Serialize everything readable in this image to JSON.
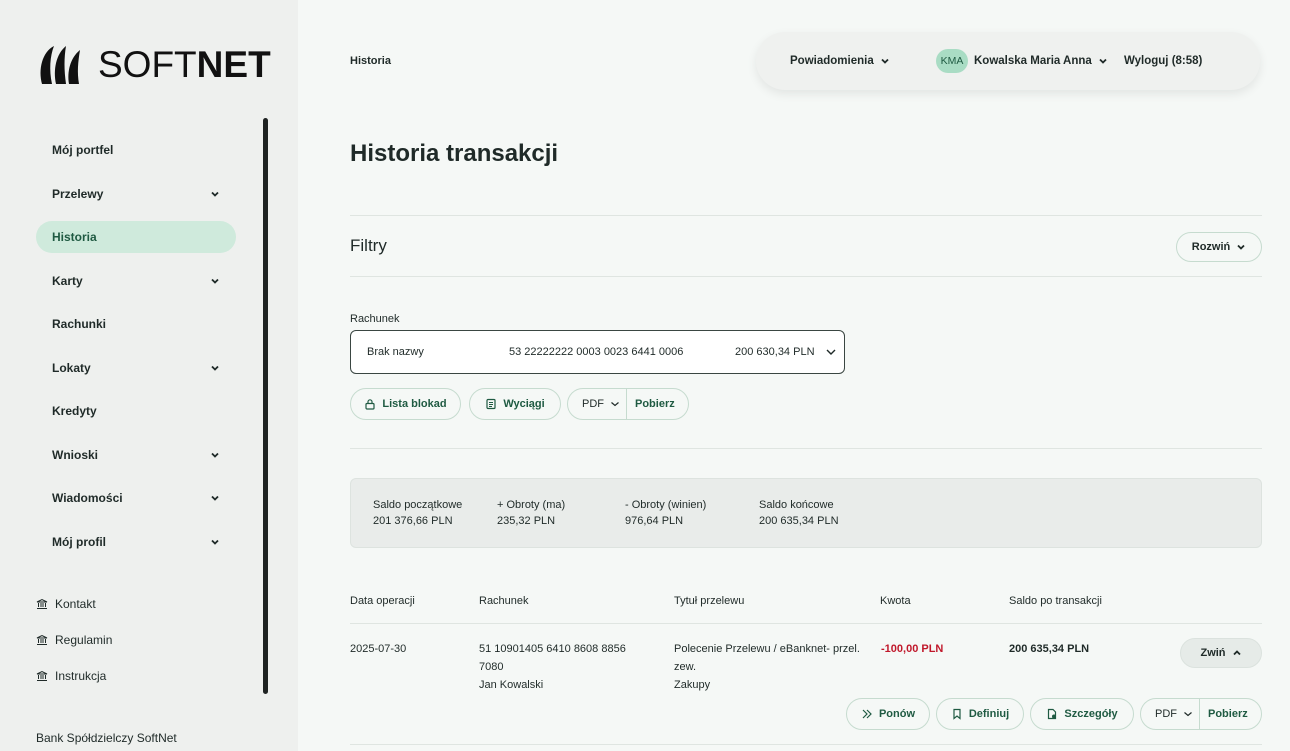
{
  "brand": {
    "logo_prefix": "SOFT",
    "logo_bold": "NET",
    "bank_name": "Bank Spółdzielczy SoftNet"
  },
  "sidebar": {
    "items": [
      {
        "label": "Mój portfel",
        "has_chevron": false,
        "active": false
      },
      {
        "label": "Przelewy",
        "has_chevron": true,
        "active": false
      },
      {
        "label": "Historia",
        "has_chevron": false,
        "active": true
      },
      {
        "label": "Karty",
        "has_chevron": true,
        "active": false
      },
      {
        "label": "Rachunki",
        "has_chevron": false,
        "active": false
      },
      {
        "label": "Lokaty",
        "has_chevron": true,
        "active": false
      },
      {
        "label": "Kredyty",
        "has_chevron": false,
        "active": false
      },
      {
        "label": "Wnioski",
        "has_chevron": true,
        "active": false
      },
      {
        "label": "Wiadomości",
        "has_chevron": true,
        "active": false
      },
      {
        "label": "Mój profil",
        "has_chevron": true,
        "active": false
      }
    ],
    "links": [
      {
        "label": "Kontakt",
        "icon": "bank-icon"
      },
      {
        "label": "Regulamin",
        "icon": "bank-icon"
      },
      {
        "label": "Instrukcja",
        "icon": "bank-icon"
      }
    ]
  },
  "header": {
    "breadcrumb": "Historia",
    "notifications": "Powiadomienia",
    "user_initials": "KMA",
    "user_name": "Kowalska Maria Anna",
    "logout": "Wyloguj (8:58)"
  },
  "main": {
    "title": "Historia transakcji",
    "filters": {
      "title": "Filtry",
      "expand": "Rozwiń"
    },
    "account": {
      "label": "Rachunek",
      "name": "Brak nazwy",
      "number": "53 22222222 0003 0023 6441 0006",
      "balance": "200 630,34 PLN"
    },
    "actions": {
      "blocks": "Lista blokad",
      "statements": "Wyciągi",
      "format": "PDF",
      "download": "Pobierz"
    },
    "summary": [
      {
        "label": "Saldo początkowe",
        "value": "201 376,66 PLN"
      },
      {
        "label": "+ Obroty (ma)",
        "value": "235,32 PLN"
      },
      {
        "label": "- Obroty (winien)",
        "value": "976,64 PLN"
      },
      {
        "label": "Saldo końcowe",
        "value": "200 635,34 PLN"
      }
    ],
    "table": {
      "headers": [
        "Data operacji",
        "Rachunek",
        "Tytuł przelewu",
        "Kwota",
        "Saldo po transakcji"
      ],
      "row": {
        "date": "2025-07-30",
        "account_line1": "51 10901405 6410 8608 8856",
        "account_line2": "7080",
        "account_owner": "Jan Kowalski",
        "title_line1": "Polecenie Przelewu / eBanknet- przel.",
        "title_line2": "zew.",
        "title_line3": "Zakupy",
        "amount": "-100,00 PLN",
        "balance": "200 635,34 PLN",
        "collapse": "Zwiń",
        "repeat": "Ponów",
        "define": "Definiuj",
        "details": "Szczegóły",
        "format": "PDF",
        "download": "Pobierz"
      }
    }
  },
  "colors": {
    "accent": "#1f5a42",
    "active_bg": "#cfeadc",
    "negative": "#c0182b"
  }
}
